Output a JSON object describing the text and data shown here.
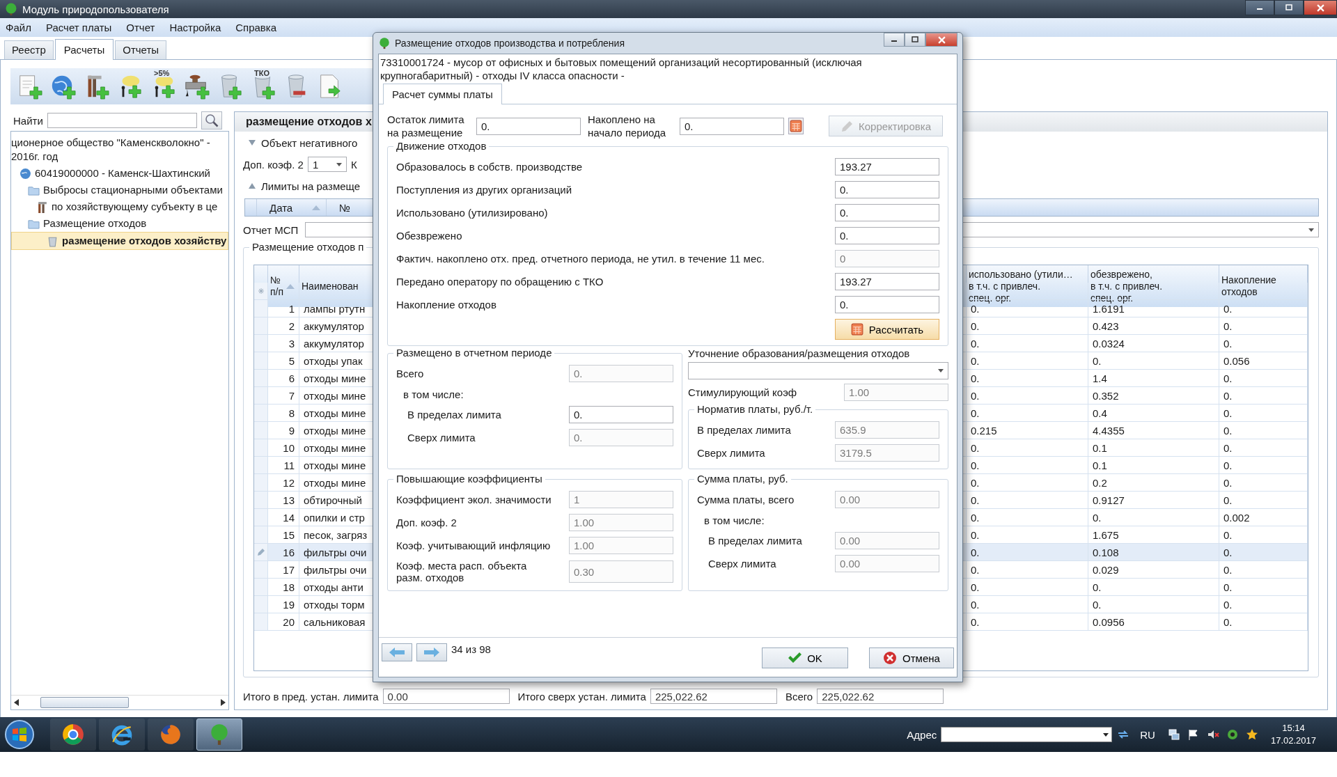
{
  "window": {
    "title": "Модуль природопользователя"
  },
  "menu": [
    "Файл",
    "Расчет платы",
    "Отчет",
    "Настройка",
    "Справка"
  ],
  "tabs": [
    {
      "label": "Реестр",
      "selected": false
    },
    {
      "label": "Расчеты",
      "selected": true
    },
    {
      "label": "Отчеты",
      "selected": false
    }
  ],
  "toolbar": [
    {
      "kind": "doc-add"
    },
    {
      "kind": "globe-add"
    },
    {
      "kind": "tool-add"
    },
    {
      "kind": "tree-add"
    },
    {
      "kind": "tree-add",
      "label": ">5%"
    },
    {
      "kind": "pipe-add"
    },
    {
      "kind": "bin-add"
    },
    {
      "kind": "bin-add",
      "label": "ТКО"
    },
    {
      "kind": "bin-remove"
    },
    {
      "kind": "doc-export"
    }
  ],
  "search": {
    "label": "Найти"
  },
  "tree": [
    {
      "kind": "org",
      "label": "ционерное общество \"Каменскволокно\" - 2016г. год",
      "selected": false,
      "children": [
        {
          "kind": "region",
          "label": "60419000000 - Каменск-Шахтинский",
          "selected": false,
          "children": [
            {
              "kind": "folder",
              "label": "Выбросы стационарными объектами",
              "selected": false,
              "children": [
                {
                  "kind": "tool",
                  "label": "по хозяйствующему субъекту в це",
                  "selected": false
                }
              ]
            },
            {
              "kind": "folder",
              "label": "Размещение отходов",
              "selected": false,
              "children": [
                {
                  "kind": "bin",
                  "label": "размещение отходов хозяйству",
                  "selected": true
                }
              ]
            }
          ]
        }
      ]
    }
  ],
  "detail": {
    "title": "размещение отходов х",
    "object_section": {
      "label": "Объект негативного",
      "expanded": false
    },
    "extra_coef": {
      "label": "Доп. коэф. 2",
      "value": "1",
      "next_label": "К"
    },
    "limits_section": {
      "label": "Лимиты на размеще",
      "expanded": true,
      "columns": [
        "Дата",
        "№"
      ]
    },
    "report": {
      "label": "Отчет МСП"
    },
    "placement": {
      "title": "Размещение отходов п",
      "columns": [
        "№\nп/п",
        "Наименован",
        "использовано (утили…\nв т.ч. с привлеч.\nспец. орг.",
        "обезврежено,\nв т.ч. с привлеч.\nспец. орг.",
        "Накопление\nотходов"
      ],
      "rows": [
        {
          "number": "1",
          "name": "лампы ртутн",
          "used": "0.",
          "neutralized": "1.6191",
          "accumulation": "0.",
          "selected": false
        },
        {
          "number": "2",
          "name": "аккумулятор",
          "used": "0.",
          "neutralized": "0.423",
          "accumulation": "0.",
          "selected": false
        },
        {
          "number": "3",
          "name": "аккумулятор",
          "used": "0.",
          "neutralized": "0.0324",
          "accumulation": "0.",
          "selected": false
        },
        {
          "number": "5",
          "name": "отходы упак",
          "used": "0.",
          "neutralized": "0.",
          "accumulation": "0.056",
          "selected": false
        },
        {
          "number": "6",
          "name": "отходы мине",
          "used": "0.",
          "neutralized": "1.4",
          "accumulation": "0.",
          "selected": false
        },
        {
          "number": "7",
          "name": "отходы мине",
          "used": "0.",
          "neutralized": "0.352",
          "accumulation": "0.",
          "selected": false
        },
        {
          "number": "8",
          "name": "отходы мине",
          "used": "0.",
          "neutralized": "0.4",
          "accumulation": "0.",
          "selected": false
        },
        {
          "number": "9",
          "name": "отходы мине",
          "used": "0.215",
          "neutralized": "4.4355",
          "accumulation": "0.",
          "selected": false
        },
        {
          "number": "10",
          "name": "отходы мине",
          "used": "0.",
          "neutralized": "0.1",
          "accumulation": "0.",
          "selected": false
        },
        {
          "number": "11",
          "name": "отходы мине",
          "used": "0.",
          "neutralized": "0.1",
          "accumulation": "0.",
          "selected": false
        },
        {
          "number": "12",
          "name": "отходы мине",
          "used": "0.",
          "neutralized": "0.2",
          "accumulation": "0.",
          "selected": false
        },
        {
          "number": "13",
          "name": "обтирочный",
          "used": "0.",
          "neutralized": "0.9127",
          "accumulation": "0.",
          "selected": false
        },
        {
          "number": "14",
          "name": "опилки и стр",
          "used": "0.",
          "neutralized": "0.",
          "accumulation": "0.002",
          "selected": false
        },
        {
          "number": "15",
          "name": "песок, загряз",
          "used": "0.",
          "neutralized": "1.675",
          "accumulation": "0.",
          "selected": false
        },
        {
          "number": "16",
          "name": "фильтры очи",
          "used": "0.",
          "neutralized": "0.108",
          "accumulation": "0.",
          "selected": true
        },
        {
          "number": "17",
          "name": "фильтры очи",
          "used": "0.",
          "neutralized": "0.029",
          "accumulation": "0.",
          "selected": false
        },
        {
          "number": "18",
          "name": "отходы анти",
          "used": "0.",
          "neutralized": "0.",
          "accumulation": "0.",
          "selected": false
        },
        {
          "number": "19",
          "name": "отходы торм",
          "used": "0.",
          "neutralized": "0.",
          "accumulation": "0.",
          "selected": false
        },
        {
          "number": "20",
          "name": "сальниковая",
          "used": "0.",
          "neutralized": "0.0956",
          "accumulation": "0.",
          "selected": false
        }
      ]
    },
    "totals": [
      {
        "label": "Итого в пред. устан. лимита",
        "value": "0.00"
      },
      {
        "label": "Итого сверх устан. лимита",
        "value": "225,022.62"
      },
      {
        "label": "Всего",
        "value": "225,022.62"
      }
    ]
  },
  "dialog": {
    "title": "Размещение отходов производства и потребления",
    "description": "73310001724 - мусор от офисных и бытовых помещений организаций несортированный (исключая крупногабаритный) - отходы IV класса опасности -",
    "tab": "Расчет суммы платы",
    "top_fields": [
      {
        "label": "Остаток лимита на размещение",
        "value": "0.",
        "disabled": false
      },
      {
        "label": "Накоплено на начало периода",
        "value": "0.",
        "disabled": false
      }
    ],
    "correction_button": {
      "label": "Корректировка",
      "disabled": true
    },
    "movement": {
      "title": "Движение отходов",
      "calculate": "Рассчитать",
      "rows": [
        {
          "label": "Образовалось в собств. производстве",
          "value": "193.27",
          "disabled": false
        },
        {
          "label": "Поступления из других организаций",
          "value": "0.",
          "disabled": false
        },
        {
          "label": "Использовано (утилизировано)",
          "value": "0.",
          "disabled": false
        },
        {
          "label": "Обезврежено",
          "value": "0.",
          "disabled": false
        },
        {
          "label": "Фактич. накоплено отх. пред. отчетного периода, не утил. в течение 11 мес.",
          "value": "0",
          "disabled": true
        },
        {
          "label": "Передано оператору по обращению с ТКО",
          "value": "193.27",
          "disabled": false
        },
        {
          "label": "Накопление отходов",
          "value": "0.",
          "disabled": false
        }
      ]
    },
    "placed": {
      "title": "Размещено в отчетном периоде",
      "rows": [
        {
          "kind": "field",
          "label": "Всего",
          "value": "0.",
          "disabled": true
        },
        {
          "kind": "caption",
          "label": "в том числе:"
        },
        {
          "kind": "subfield",
          "label": "В пределах лимита",
          "value": "0.",
          "disabled": false
        },
        {
          "kind": "subfield",
          "label": "Сверх лимита",
          "value": "0.",
          "disabled": true
        }
      ]
    },
    "refinement": {
      "label": "Уточнение образования/размещения отходов"
    },
    "stimulating": {
      "label": "Стимулирующий коэф",
      "value": "1.00",
      "disabled": true
    },
    "norm": {
      "title": "Норматив платы, руб./т.",
      "rows": [
        {
          "label": "В пределах лимита",
          "value": "635.9",
          "disabled": true
        },
        {
          "label": "Сверх лимита",
          "value": "3179.5",
          "disabled": true
        }
      ]
    },
    "coefficients": {
      "title": "Повышающие коэффициенты",
      "rows": [
        {
          "kind": "field",
          "label": "Коэффициент экол. значимости",
          "value": "1",
          "disabled": true
        },
        {
          "kind": "field",
          "label": "Доп. коэф. 2",
          "value": "1.00",
          "disabled": true
        },
        {
          "kind": "field",
          "label": "Коэф. учитывающий инфляцию",
          "value": "1.00",
          "disabled": true
        },
        {
          "kind": "tall",
          "label": "Коэф. места расп. объекта разм. отходов",
          "value": "0.30",
          "disabled": true
        }
      ]
    },
    "sum": {
      "title": "Сумма платы, руб.",
      "rows": [
        {
          "kind": "field",
          "label": "Сумма платы, всего",
          "value": "0.00",
          "disabled": true
        },
        {
          "kind": "caption",
          "label": "в том числе:"
        },
        {
          "kind": "subfield",
          "label": "В пределах лимита",
          "value": "0.00",
          "disabled": true
        },
        {
          "kind": "subfield",
          "label": "Сверх лимита",
          "value": "0.00",
          "disabled": true
        }
      ]
    },
    "counter": "34 из 98",
    "ok": "OK",
    "cancel": "Отмена"
  },
  "taskbar": {
    "apps": [
      {
        "kind": "chrome",
        "selected": false
      },
      {
        "kind": "ie",
        "selected": false
      },
      {
        "kind": "firefox",
        "selected": false
      },
      {
        "kind": "tree",
        "selected": true
      }
    ],
    "address_label": "Адрес",
    "language": "RU",
    "time": "15:14",
    "date": "17.02.2017"
  }
}
